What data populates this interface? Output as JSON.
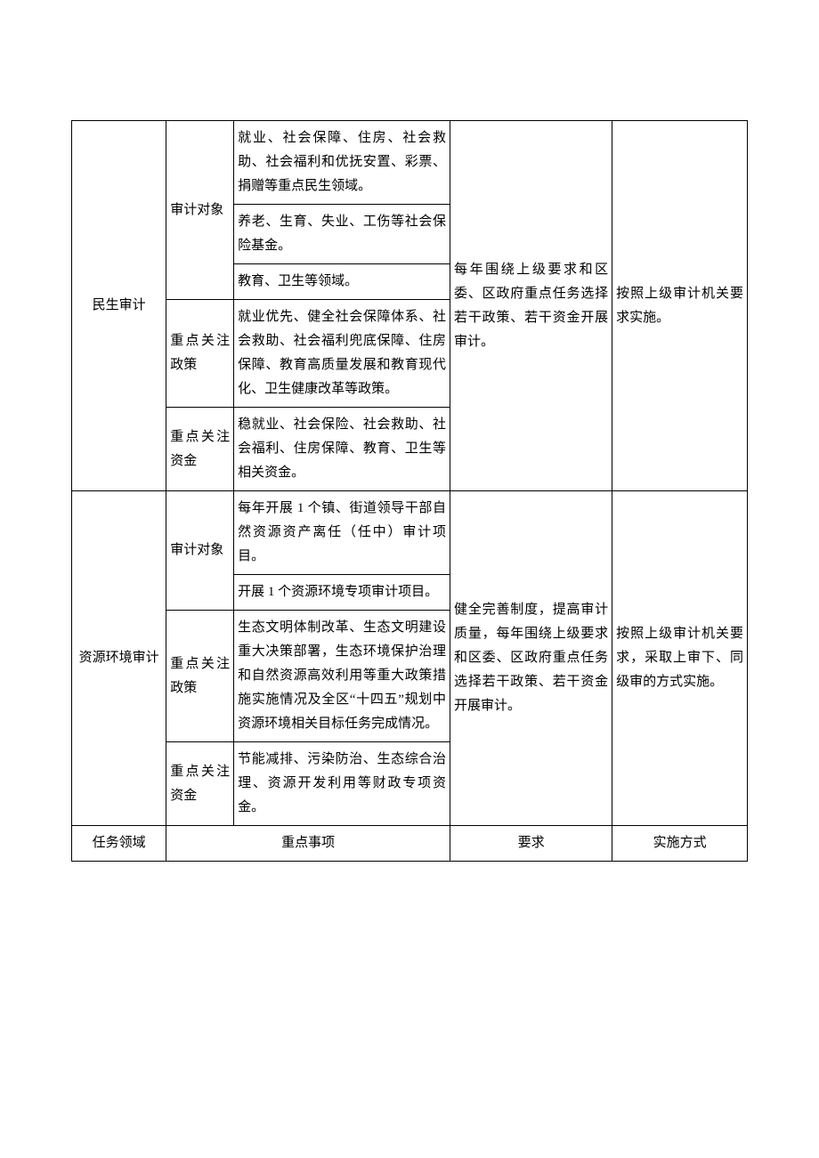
{
  "sections": {
    "minsheng": {
      "name": "民生审计",
      "subjectLabel": "审计对象",
      "subjectItems": [
        "就业、社会保障、住房、社会救助、社会福利和优抚安置、彩票、捐赠等重点民生领域。",
        "养老、生育、失业、工伤等社会保险基金。",
        "教育、卫生等领域。"
      ],
      "policyLabel": "重点关注政策",
      "policyText": "就业优先、健全社会保障体系、社会救助、社会福利兜底保障、住房保障、教育高质量发展和教育现代化、卫生健康改革等政策。",
      "fundsLabel": "重点关注资金",
      "fundsText": "稳就业、社会保险、社会救助、社会福利、住房保障、教育、卫生等相关资金。",
      "requirement": "每年围绕上级要求和区委、区政府重点任务选择若干政策、若干资金开展审计。",
      "method": "按照上级审计机关要求实施。"
    },
    "ziyuan": {
      "name": "资源环境审计",
      "subjectLabel": "审计对象",
      "subjectItems": [
        "每年开展 1 个镇、街道领导干部自然资源资产离任（任中）审计项目。",
        "开展 1 个资源环境专项审计项目。"
      ],
      "policyLabel": "重点关注政策",
      "policyText": "生态文明体制改革、生态文明建设重大决策部署，生态环境保护治理和自然资源高效利用等重大政策措施实施情况及全区“十四五”规划中资源环境相关目标任务完成情况。",
      "fundsLabel": "重点关注资金",
      "fundsText": "节能减排、污染防治、生态综合治理、资源开发利用等财政专项资金。",
      "requirement": "健全完善制度，提高审计质量，每年围绕上级要求和区委、区政府重点任务选择若干政策、若干资金开展审计。",
      "method": "按照上级审计机关要求，采取上审下、同级审的方式实施。"
    }
  },
  "footer": {
    "col1": "任务领域",
    "col2": "重点事项",
    "col3": "要求",
    "col4": "实施方式"
  }
}
